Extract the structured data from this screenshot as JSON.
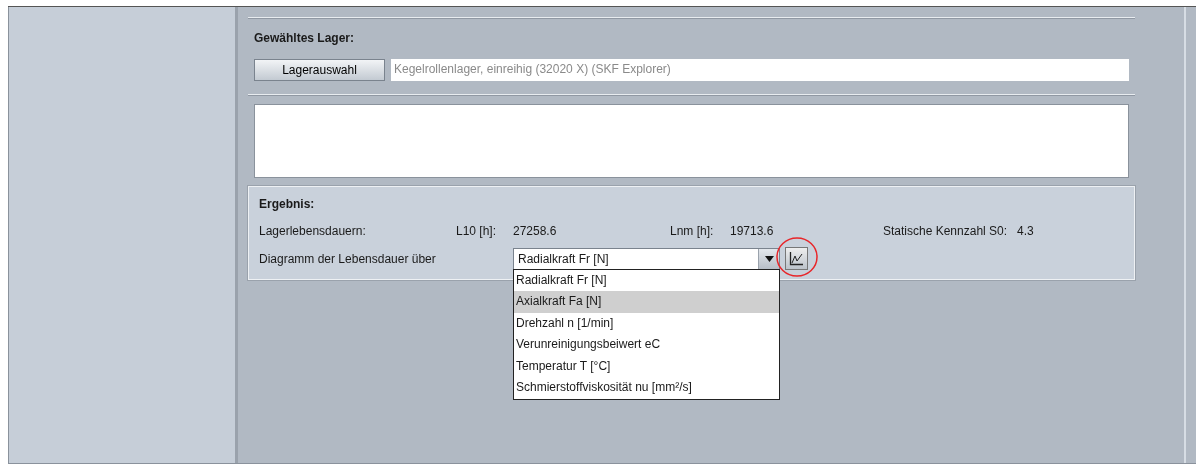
{
  "selected_bearing": {
    "heading": "Gewähltes Lager:",
    "button": "Lagerauswahl",
    "value": "Kegelrollenlager, einreihig (32020 X) (SKF Explorer)"
  },
  "result": {
    "heading": "Ergebnis:",
    "lifetime_label": "Lagerlebensdauern:",
    "metrics": [
      {
        "label": "L10 [h]:",
        "value": "27258.6"
      },
      {
        "label": "Lnm [h]:",
        "value": "19713.6"
      },
      {
        "label": "Statische Kennzahl S0:",
        "value": "4.3"
      }
    ],
    "diagram_label": "Diagramm der Lebensdauer über",
    "combo": {
      "value": "Radialkraft Fr [N]",
      "expanded": true,
      "options": [
        {
          "label": "Radialkraft Fr [N]",
          "highlighted": false
        },
        {
          "label": "Axialkraft Fa [N]",
          "highlighted": true
        },
        {
          "label": "Drehzahl n [1/min]",
          "highlighted": false
        },
        {
          "label": "Verunreinigungsbeiwert eC",
          "highlighted": false
        },
        {
          "label": "Temperatur T [°C]",
          "highlighted": false
        },
        {
          "label": "Schmierstoffviskosität nu [mm²/s]",
          "highlighted": false
        }
      ]
    },
    "chart_button": {
      "circled": true
    }
  }
}
